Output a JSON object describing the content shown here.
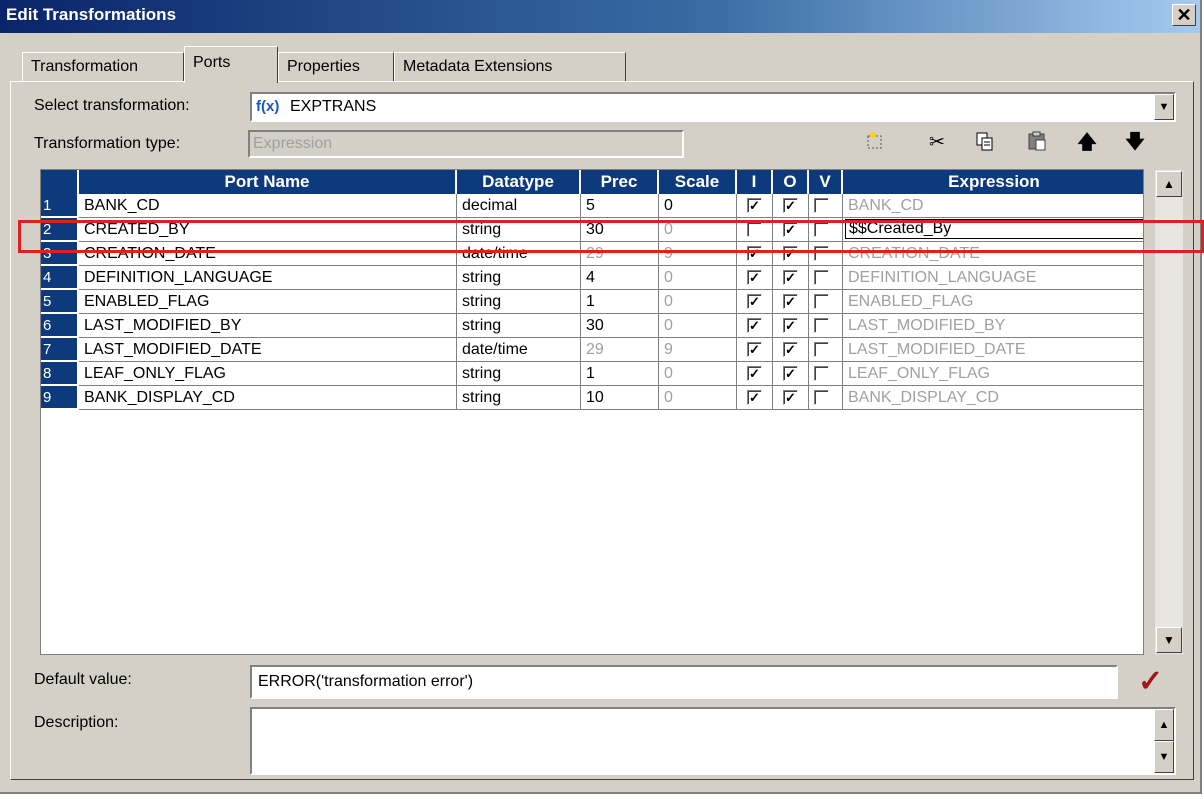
{
  "window": {
    "title": "Edit Transformations",
    "close_label": "✕"
  },
  "tabs": [
    {
      "label": "Transformation"
    },
    {
      "label": "Ports"
    },
    {
      "label": "Properties"
    },
    {
      "label": "Metadata Extensions"
    }
  ],
  "select_transformation": {
    "label": "Select transformation:",
    "icon": "f(x)",
    "value": "EXPTRANS"
  },
  "transformation_type": {
    "label": "Transformation type:",
    "value": "Expression"
  },
  "toolbar": [
    "new-port-icon",
    "cut-icon",
    "copy-icon",
    "paste-icon",
    "move-up-icon",
    "move-down-icon"
  ],
  "columns": [
    "",
    "Port Name",
    "Datatype",
    "Prec",
    "Scale",
    "I",
    "O",
    "V",
    "Expression"
  ],
  "ports": [
    {
      "num": "1",
      "name": "BANK_CD",
      "datatype": "decimal",
      "prec": "5",
      "scale": "0",
      "i": true,
      "o": true,
      "v": false,
      "expr": "BANK_CD",
      "prec_gray": false,
      "scale_gray": false,
      "expr_gray": true
    },
    {
      "num": "2",
      "name": "CREATED_BY",
      "datatype": "string",
      "prec": "30",
      "scale": "0",
      "i": false,
      "o": true,
      "v": false,
      "expr": "$$Created_By",
      "prec_gray": false,
      "scale_gray": true,
      "expr_gray": false
    },
    {
      "num": "3",
      "name": "CREATION_DATE",
      "datatype": "date/time",
      "prec": "29",
      "scale": "9",
      "i": true,
      "o": true,
      "v": false,
      "expr": "CREATION_DATE",
      "prec_gray": true,
      "scale_gray": true,
      "expr_gray": true
    },
    {
      "num": "4",
      "name": "DEFINITION_LANGUAGE",
      "datatype": "string",
      "prec": "4",
      "scale": "0",
      "i": true,
      "o": true,
      "v": false,
      "expr": "DEFINITION_LANGUAGE",
      "prec_gray": false,
      "scale_gray": true,
      "expr_gray": true
    },
    {
      "num": "5",
      "name": "ENABLED_FLAG",
      "datatype": "string",
      "prec": "1",
      "scale": "0",
      "i": true,
      "o": true,
      "v": false,
      "expr": "ENABLED_FLAG",
      "prec_gray": false,
      "scale_gray": true,
      "expr_gray": true
    },
    {
      "num": "6",
      "name": "LAST_MODIFIED_BY",
      "datatype": "string",
      "prec": "30",
      "scale": "0",
      "i": true,
      "o": true,
      "v": false,
      "expr": "LAST_MODIFIED_BY",
      "prec_gray": false,
      "scale_gray": true,
      "expr_gray": true
    },
    {
      "num": "7",
      "name": "LAST_MODIFIED_DATE",
      "datatype": "date/time",
      "prec": "29",
      "scale": "9",
      "i": true,
      "o": true,
      "v": false,
      "expr": "LAST_MODIFIED_DATE",
      "prec_gray": true,
      "scale_gray": true,
      "expr_gray": true
    },
    {
      "num": "8",
      "name": "LEAF_ONLY_FLAG",
      "datatype": "string",
      "prec": "1",
      "scale": "0",
      "i": true,
      "o": true,
      "v": false,
      "expr": "LEAF_ONLY_FLAG",
      "prec_gray": false,
      "scale_gray": true,
      "expr_gray": true
    },
    {
      "num": "9",
      "name": "BANK_DISPLAY_CD",
      "datatype": "string",
      "prec": "10",
      "scale": "0",
      "i": true,
      "o": true,
      "v": false,
      "expr": "BANK_DISPLAY_CD",
      "prec_gray": false,
      "scale_gray": true,
      "expr_gray": true
    }
  ],
  "default_value": {
    "label": "Default value:",
    "value": "ERROR('transformation error')"
  },
  "description": {
    "label": "Description:",
    "value": ""
  },
  "colors": {
    "header_bg": "#0d3a7d",
    "highlight": "#e02020",
    "dialog_bg": "#d4d0c8",
    "validate_check": "#a01818"
  }
}
